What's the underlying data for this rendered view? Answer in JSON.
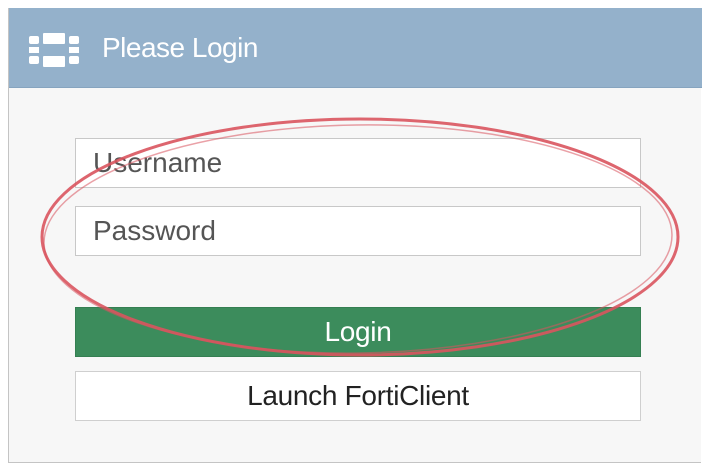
{
  "header": {
    "title": "Please Login",
    "logo_icon": "fortinet-logo-icon",
    "background_color": "#94b1cb"
  },
  "form": {
    "username": {
      "placeholder": "Username",
      "value": ""
    },
    "password": {
      "placeholder": "Password",
      "value": ""
    },
    "login_button_label": "Login",
    "login_button_color": "#3c8c5c",
    "launch_button_label": "Launch FortiClient"
  },
  "annotation": {
    "shape": "ellipse",
    "color": "#d9545e",
    "highlights": "username and password fields"
  }
}
